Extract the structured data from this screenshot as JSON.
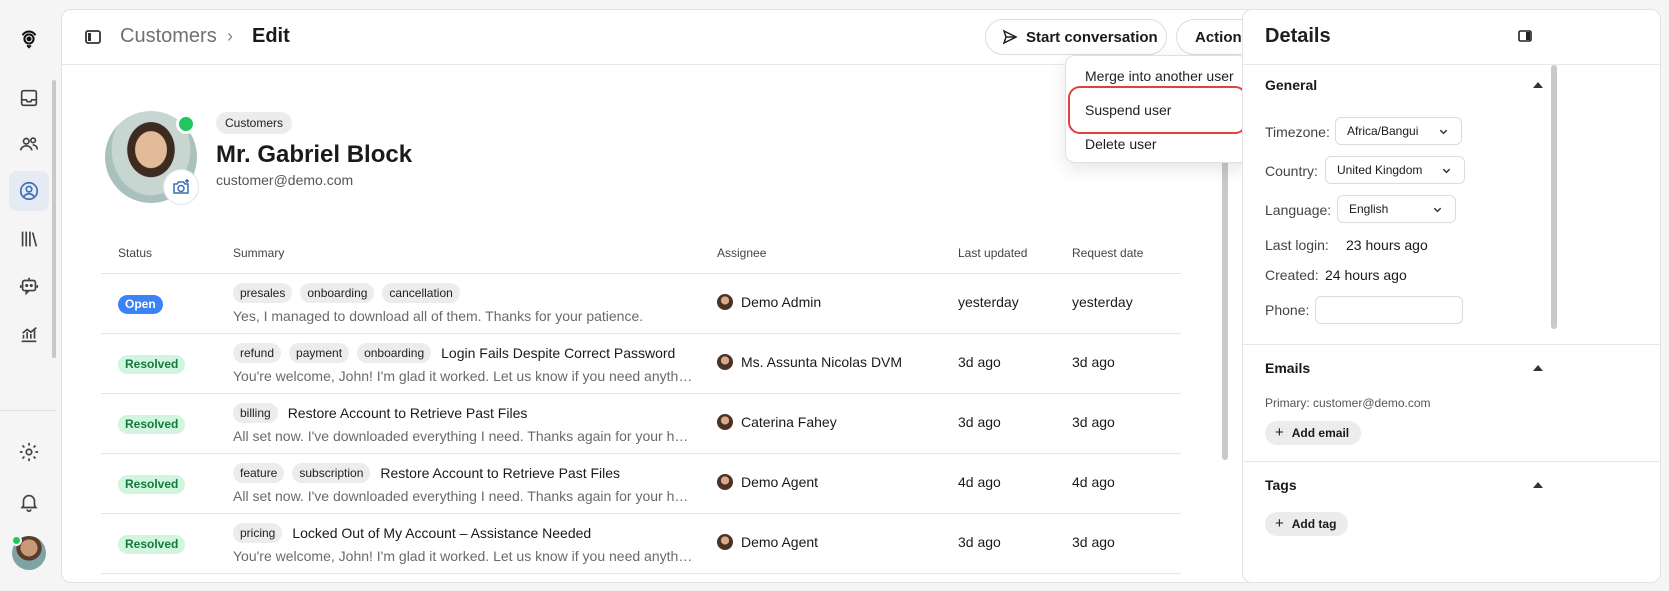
{
  "rail": {
    "icons": [
      "logo-icon",
      "inbox-icon",
      "users-icon",
      "user-circle-icon",
      "library-icon",
      "bot-icon",
      "chart-icon",
      "gear-icon",
      "bell-icon"
    ]
  },
  "header": {
    "breadcrumb_parent": "Customers",
    "breadcrumb_separator": "›",
    "breadcrumb_current": "Edit",
    "start_conversation_label": "Start conversation",
    "actions_label": "Actions"
  },
  "actions_menu": {
    "items": [
      "Merge into another user",
      "Suspend user",
      "Delete user"
    ],
    "highlighted": "Suspend user"
  },
  "profile": {
    "tag": "Customers",
    "name": "Mr. Gabriel Block",
    "email": "customer@demo.com"
  },
  "table": {
    "columns": [
      "Status",
      "Summary",
      "Assignee",
      "Last updated",
      "Request date"
    ],
    "rows": [
      {
        "status": "Open",
        "tags": [
          "presales",
          "onboarding",
          "cancellation"
        ],
        "subject": "",
        "preview": "Yes, I managed to download all of them. Thanks for your patience.",
        "assignee": "Demo Admin",
        "updated": "yesterday",
        "requested": "yesterday"
      },
      {
        "status": "Resolved",
        "tags": [
          "refund",
          "payment",
          "onboarding"
        ],
        "subject": "Login Fails Despite Correct Password",
        "preview": "You're welcome, John! I'm glad it worked. Let us know if you need anythin...",
        "assignee": "Ms. Assunta Nicolas DVM",
        "updated": "3d ago",
        "requested": "3d ago"
      },
      {
        "status": "Resolved",
        "tags": [
          "billing"
        ],
        "subject": "Restore Account to Retrieve Past Files",
        "preview": "All set now. I've downloaded everything I need. Thanks again for your help...",
        "assignee": "Caterina Fahey",
        "updated": "3d ago",
        "requested": "3d ago"
      },
      {
        "status": "Resolved",
        "tags": [
          "feature",
          "subscription"
        ],
        "subject": "Restore Account to Retrieve Past Files",
        "preview": "All set now. I've downloaded everything I need. Thanks again for your help...",
        "assignee": "Demo Agent",
        "updated": "4d ago",
        "requested": "4d ago"
      },
      {
        "status": "Resolved",
        "tags": [
          "pricing"
        ],
        "subject": "Locked Out of My Account – Assistance Needed",
        "preview": "You're welcome, John! I'm glad it worked. Let us know if you need anythin...",
        "assignee": "Demo Agent",
        "updated": "3d ago",
        "requested": "3d ago"
      }
    ]
  },
  "details": {
    "title": "Details",
    "general": {
      "title": "General",
      "timezone_label": "Timezone:",
      "timezone_value": "Africa/Bangui",
      "country_label": "Country:",
      "country_value": "United Kingdom",
      "language_label": "Language:",
      "language_value": "English",
      "last_login_label": "Last login:",
      "last_login_value": "23 hours ago",
      "created_label": "Created:",
      "created_value": "24 hours ago",
      "phone_label": "Phone:",
      "phone_value": ""
    },
    "emails": {
      "title": "Emails",
      "primary": "Primary: customer@demo.com",
      "add_label": "Add email"
    },
    "tags": {
      "title": "Tags",
      "add_label": "Add tag"
    }
  },
  "colors": {
    "accent": "#3b6fb6",
    "open": "#3b82f6",
    "resolved_bg": "#d1f5de",
    "resolved_text": "#147a3c",
    "highlight": "#e0413a",
    "online": "#22c55e"
  }
}
